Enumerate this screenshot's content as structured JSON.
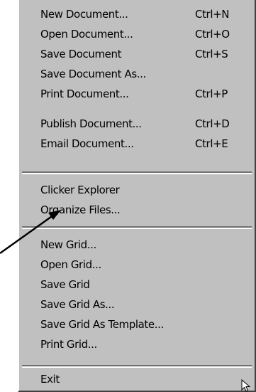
{
  "menu": {
    "items": [
      {
        "label": "New Document...",
        "shortcut": "Ctrl+N"
      },
      {
        "label": "Open Document...",
        "shortcut": "Ctrl+O"
      },
      {
        "label": "Save Document",
        "shortcut": "Ctrl+S"
      },
      {
        "label": "Save Document As...",
        "shortcut": ""
      },
      {
        "label": "Print Document...",
        "shortcut": "Ctrl+P"
      },
      {
        "label": "Publish Document...",
        "shortcut": "Ctrl+D"
      },
      {
        "label": "Email Document...",
        "shortcut": "Ctrl+E"
      },
      {
        "label": "Clicker Explorer",
        "shortcut": ""
      },
      {
        "label": "Organize Files...",
        "shortcut": ""
      },
      {
        "label": "New Grid...",
        "shortcut": ""
      },
      {
        "label": "Open Grid...",
        "shortcut": ""
      },
      {
        "label": "Save Grid",
        "shortcut": ""
      },
      {
        "label": "Save Grid As...",
        "shortcut": ""
      },
      {
        "label": "Save Grid As Template...",
        "shortcut": ""
      },
      {
        "label": "Print Grid...",
        "shortcut": ""
      },
      {
        "label": "Exit",
        "shortcut": ""
      }
    ]
  },
  "annotation": {
    "icon": "callout-arrow-icon"
  },
  "cursor": {
    "icon": "mouse-pointer-icon"
  }
}
